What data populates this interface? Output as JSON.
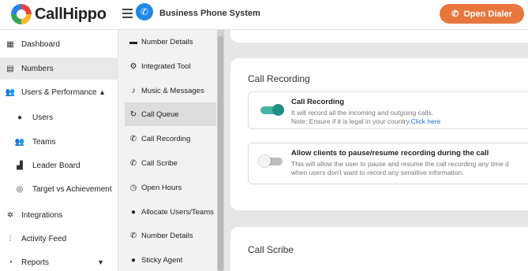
{
  "header": {
    "logo_text": "CallHippo",
    "app_title": "Business Phone System",
    "open_dialer_label": "Open Dialer",
    "accent_color": "#e8773d"
  },
  "sidebar": {
    "items": [
      {
        "label": "Dashboard",
        "icon": "dashboard-icon"
      },
      {
        "label": "Numbers",
        "icon": "numbers-icon"
      },
      {
        "label": "Users & Performance",
        "icon": "users-icon"
      },
      {
        "label": "Users",
        "icon": "user-icon"
      },
      {
        "label": "Teams",
        "icon": "teams-icon"
      },
      {
        "label": "Leader Board",
        "icon": "leaderboard-icon"
      },
      {
        "label": "Target vs Achievement",
        "icon": "target-icon"
      },
      {
        "label": "Integrations",
        "icon": "integrations-icon"
      },
      {
        "label": "Activity Feed",
        "icon": "activity-icon"
      },
      {
        "label": "Reports",
        "icon": "reports-icon"
      }
    ]
  },
  "submenu": {
    "items": [
      {
        "label": "Number Details",
        "icon": "briefcase-icon"
      },
      {
        "label": "Integrated Tool",
        "icon": "gear-icon"
      },
      {
        "label": "Music & Messages",
        "icon": "music-icon"
      },
      {
        "label": "Call Queue",
        "icon": "queue-icon"
      },
      {
        "label": "Call Recording",
        "icon": "phone-record-icon"
      },
      {
        "label": "Call Scribe",
        "icon": "phone-scribe-icon"
      },
      {
        "label": "Open Hours",
        "icon": "clock-icon"
      },
      {
        "label": "Allocate Users/Teams",
        "icon": "user-circle-icon"
      },
      {
        "label": "Number Details",
        "icon": "phone-details-icon"
      },
      {
        "label": "Sticky Agent",
        "icon": "agent-icon"
      }
    ]
  },
  "recording": {
    "title": "Call Recording",
    "option1": {
      "title": "Call Recording",
      "desc1": "It will record all the incoming and outgoing calls.",
      "desc2": "Note: Ensure if it is legal in your country.",
      "link": "Click here",
      "enabled": true
    },
    "option2": {
      "title": "Allow clients to pause/resume recording during the call",
      "desc1": "This will allow the user to pause and resume the call recording any time d",
      "desc2": "when users don't want to record any sensitive information.",
      "enabled": false
    }
  },
  "scribe": {
    "title": "Call Scribe"
  }
}
